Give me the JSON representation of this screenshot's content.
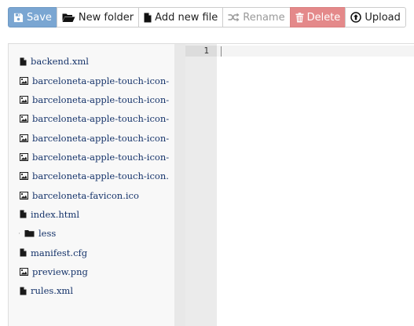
{
  "toolbar": {
    "save": "Save",
    "new_folder": "New folder",
    "add_new_file": "Add new file",
    "rename": "Rename",
    "delete": "Delete",
    "upload": "Upload"
  },
  "colors": {
    "save_button": "#7aa6d2",
    "delete_button": "#e4898a",
    "file_link": "#15336a"
  },
  "tree": [
    {
      "type": "file",
      "icon": "file-icon",
      "name": "backend.xml"
    },
    {
      "type": "image",
      "icon": "image-icon",
      "name": "barceloneta-apple-touch-icon-"
    },
    {
      "type": "image",
      "icon": "image-icon",
      "name": "barceloneta-apple-touch-icon-"
    },
    {
      "type": "image",
      "icon": "image-icon",
      "name": "barceloneta-apple-touch-icon-"
    },
    {
      "type": "image",
      "icon": "image-icon",
      "name": "barceloneta-apple-touch-icon-"
    },
    {
      "type": "image",
      "icon": "image-icon",
      "name": "barceloneta-apple-touch-icon-"
    },
    {
      "type": "image",
      "icon": "image-icon",
      "name": "barceloneta-apple-touch-icon."
    },
    {
      "type": "image",
      "icon": "image-icon",
      "name": "barceloneta-favicon.ico"
    },
    {
      "type": "file",
      "icon": "file-icon",
      "name": "index.html"
    },
    {
      "type": "folder",
      "icon": "folder-icon",
      "name": "less",
      "collapsed": true
    },
    {
      "type": "file",
      "icon": "file-icon",
      "name": "manifest.cfg"
    },
    {
      "type": "image",
      "icon": "image-icon",
      "name": "preview.png"
    },
    {
      "type": "file",
      "icon": "file-icon",
      "name": "rules.xml"
    }
  ],
  "editor": {
    "line_number": "1"
  }
}
